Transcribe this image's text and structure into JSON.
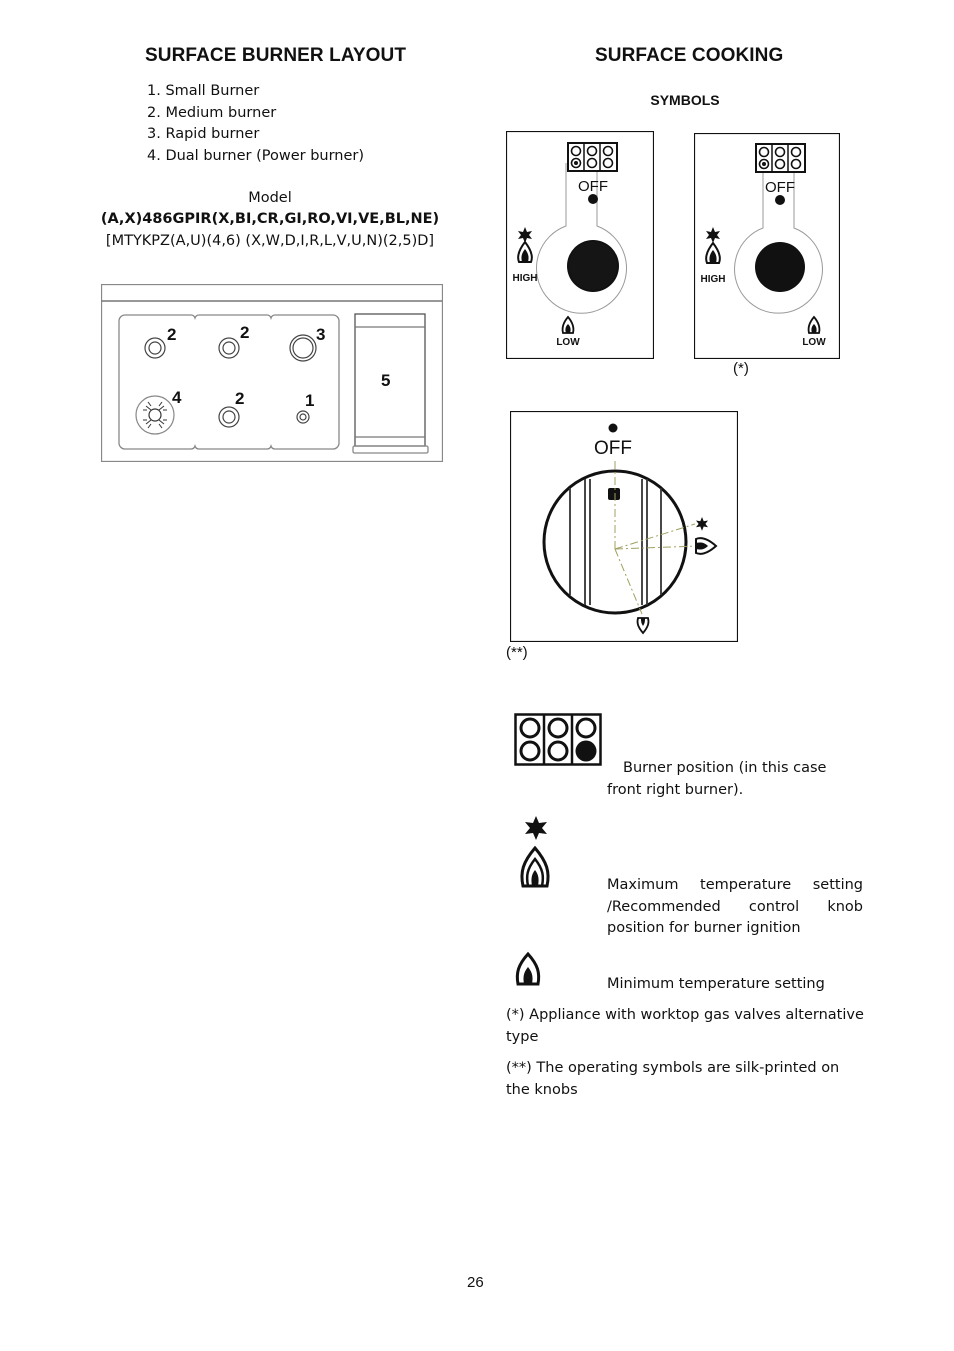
{
  "left": {
    "title": "SURFACE BURNER LAYOUT",
    "burner_list": [
      "1. Small Burner",
      "2. Medium burner",
      "3. Rapid burner",
      "4. Dual burner (Power burner)"
    ],
    "model_label": "Model",
    "model_code": "(A,X)486GPIR(X,BI,CR,GI,RO,VI,VE,BL,NE)",
    "model_variants": "[MTYKPZ(A,U)(4,6) (X,W,D,I,R,L,V,U,N)(2,5)D]",
    "diagram": {
      "labels": {
        "rear_left": "2",
        "rear_center": "2",
        "rear_right": "3",
        "front_left": "4",
        "front_center": "2",
        "front_right": "1",
        "side_unit": "5"
      }
    }
  },
  "right": {
    "title": "SURFACE COOKING",
    "subtitle": "SYMBOLS",
    "panel_a": {
      "off": "OFF",
      "high": "HIGH",
      "low": "LOW"
    },
    "panel_b": {
      "off": "OFF",
      "high": "HIGH",
      "low": "LOW",
      "caption": "(*)"
    },
    "knob": {
      "off": "OFF",
      "caption": "(**)"
    },
    "legend": [
      {
        "icon": "burner-position-icon",
        "text": "Burner position (in this case front right burner)."
      },
      {
        "icon": "max-flame-icon",
        "text": "Maximum temperature setting /Recommended control knob position for burner ignition"
      },
      {
        "icon": "min-flame-icon",
        "text": "Minimum temperature setting"
      }
    ],
    "notes": [
      "(*) Appliance with worktop gas valves alternative type",
      "(**) The operating symbols are silk-printed on the knobs"
    ]
  },
  "footer": {
    "page_number": "26"
  }
}
